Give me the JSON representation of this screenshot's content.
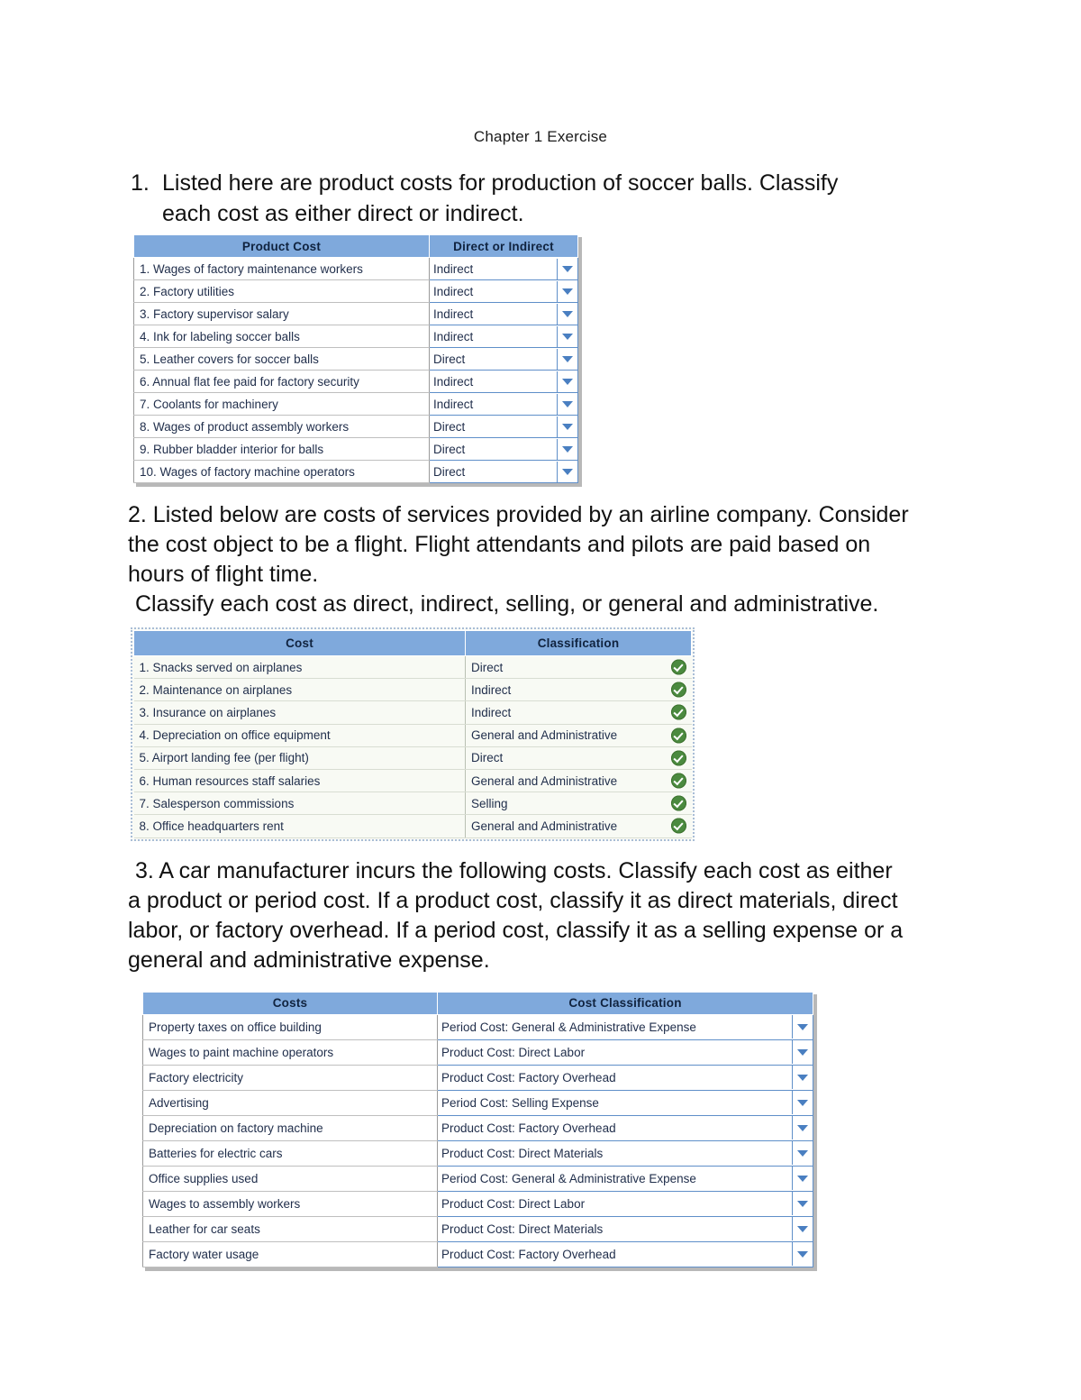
{
  "document": {
    "title": "Chapter 1 Exercise"
  },
  "question1": {
    "number": "1.",
    "line1": "Listed here are product costs for production of soccer balls. Classify",
    "line2": "each cost as either direct or indirect.",
    "table": {
      "headers": [
        "Product Cost",
        "Direct or Indirect"
      ],
      "rows": [
        {
          "cost": "1. Wages of factory maintenance workers",
          "value": "Indirect"
        },
        {
          "cost": "2. Factory utilities",
          "value": "Indirect"
        },
        {
          "cost": "3. Factory supervisor salary",
          "value": "Indirect"
        },
        {
          "cost": "4. Ink for labeling soccer balls",
          "value": "Indirect"
        },
        {
          "cost": "5. Leather covers for soccer balls",
          "value": "Direct"
        },
        {
          "cost": "6. Annual flat fee paid for factory security",
          "value": "Indirect"
        },
        {
          "cost": "7. Coolants for machinery",
          "value": "Indirect"
        },
        {
          "cost": "8. Wages of product assembly workers",
          "value": "Direct"
        },
        {
          "cost": "9. Rubber bladder interior for balls",
          "value": "Direct"
        },
        {
          "cost": "10. Wages of factory machine operators",
          "value": "Direct"
        }
      ]
    }
  },
  "question2": {
    "line1": "2. Listed below are costs of services provided by an airline company. Consider",
    "line2": "the cost object to be a flight. Flight attendants and pilots are paid based on",
    "line3": "hours of flight time.",
    "line4": "Classify each cost as direct, indirect, selling, or general and administrative.",
    "table": {
      "headers": [
        "Cost",
        "Classification"
      ],
      "rows": [
        {
          "cost": "1. Snacks served on airplanes",
          "value": "Direct",
          "status": "check-icon"
        },
        {
          "cost": "2. Maintenance on airplanes",
          "value": "Indirect",
          "status": "check-icon"
        },
        {
          "cost": "3. Insurance on airplanes",
          "value": "Indirect",
          "status": "check-icon"
        },
        {
          "cost": "4. Depreciation on office equipment",
          "value": "General and Administrative",
          "status": "check-icon"
        },
        {
          "cost": "5. Airport landing fee (per flight)",
          "value": "Direct",
          "status": "check-icon"
        },
        {
          "cost": "6. Human resources staff salaries",
          "value": "General and Administrative",
          "status": "check-icon"
        },
        {
          "cost": "7. Salesperson commissions",
          "value": "Selling",
          "status": "check-icon"
        },
        {
          "cost": "8. Office headquarters rent",
          "value": "General and Administrative",
          "status": "check-icon"
        }
      ]
    }
  },
  "question3": {
    "line1": "3. A car manufacturer incurs the following costs. Classify each cost as either",
    "line2": "a product or period cost. If a product cost, classify it as direct materials, direct",
    "line3": "labor, or factory overhead. If a period cost, classify it as a selling expense or a",
    "line4": "general and administrative expense.",
    "table": {
      "headers": [
        "Costs",
        "Cost Classification"
      ],
      "rows": [
        {
          "cost": "Property taxes on office building",
          "value": "Period Cost: General & Administrative Expense"
        },
        {
          "cost": "Wages to paint machine operators",
          "value": "Product Cost: Direct Labor"
        },
        {
          "cost": "Factory electricity",
          "value": "Product Cost: Factory Overhead"
        },
        {
          "cost": "Advertising",
          "value": "Period Cost: Selling Expense"
        },
        {
          "cost": "Depreciation on factory machine",
          "value": "Product Cost: Factory Overhead"
        },
        {
          "cost": "Batteries for electric cars",
          "value": "Product Cost: Direct Materials"
        },
        {
          "cost": "Office supplies used",
          "value": "Period Cost: General & Administrative Expense"
        },
        {
          "cost": "Wages to assembly workers",
          "value": "Product Cost: Direct Labor"
        },
        {
          "cost": "Leather for car seats",
          "value": "Product Cost: Direct Materials"
        },
        {
          "cost": "Factory water usage",
          "value": "Product Cost: Factory Overhead"
        }
      ]
    }
  },
  "icons": {
    "dropdown": "chevron-down-icon",
    "check": "check-circle-icon"
  },
  "colors": {
    "header_blue": "#7FA9DC",
    "dropdown_border": "#5f8fc9",
    "check_green": "#4b8a3f"
  }
}
